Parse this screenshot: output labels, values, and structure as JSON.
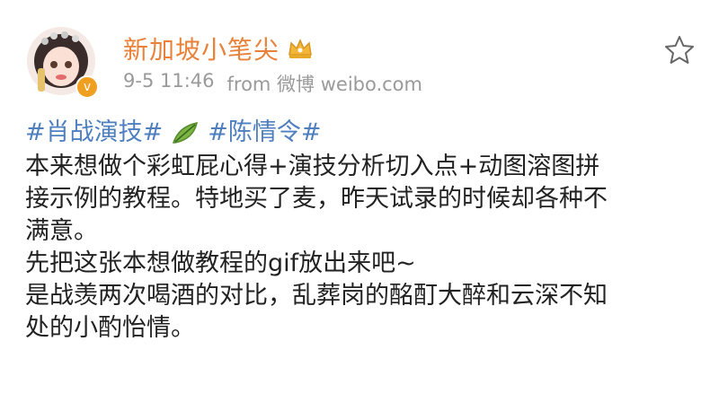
{
  "user": {
    "name": "新加坡小笔尖",
    "time": "9-5 11:46",
    "source": "from 微博 weibo.com"
  },
  "post": {
    "tags": [
      "#肖战演技#",
      "#陈情令#"
    ],
    "lines": [
      "本来想做个彩虹屁心得+演技分析切入点+动图溶图拼",
      "接示例的教程。特地买了麦，昨天试录的时候却各种不",
      "满意。",
      "先把这张本想做教程的gif放出来吧~",
      "是战羡两次喝酒的对比，乱葬岗的酩酊大醉和云深不知",
      "处的小酌怡情。"
    ]
  },
  "icons": {
    "vip": "crown-icon",
    "favorite": "star-outline-icon",
    "verified": "verified-badge-icon",
    "tag_emoji": "leaf-icon"
  },
  "colors": {
    "name": "#e8823a",
    "tag": "#4f7fbf",
    "meta": "#9a9a9a",
    "text": "#222222"
  }
}
